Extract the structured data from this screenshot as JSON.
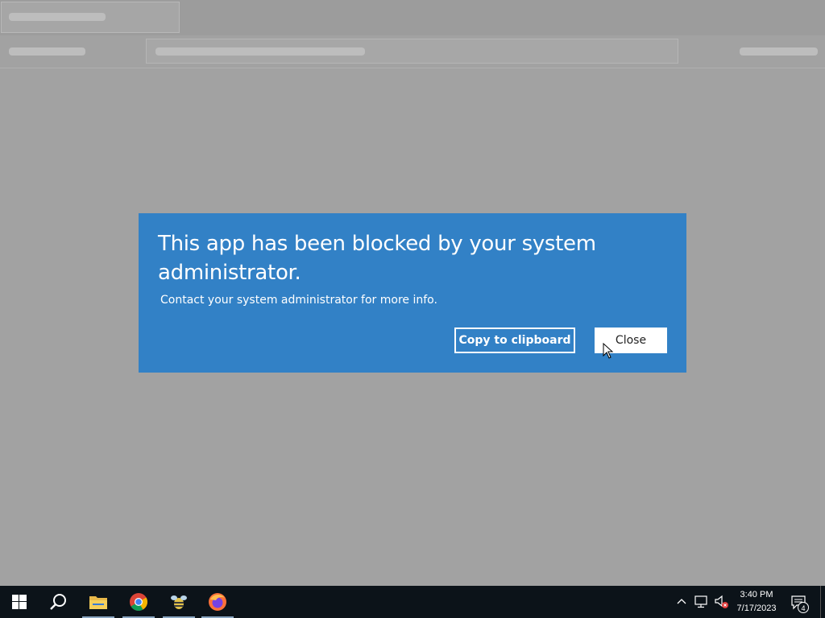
{
  "dialog": {
    "title": "This app has been blocked by your system administrator.",
    "message": "Contact your system administrator for more info.",
    "copy_button": "Copy to clipboard",
    "close_button": "Close",
    "background_color": "#3281c6"
  },
  "taskbar": {
    "items": [
      {
        "name": "start",
        "icon": "windows-logo-icon"
      },
      {
        "name": "search",
        "icon": "search-icon"
      },
      {
        "name": "file-explorer",
        "icon": "folder-icon"
      },
      {
        "name": "chrome",
        "icon": "chrome-icon"
      },
      {
        "name": "app",
        "icon": "bee-app-icon"
      },
      {
        "name": "firefox",
        "icon": "firefox-icon"
      }
    ],
    "time": "3:40 PM",
    "date": "7/17/2023",
    "notification_count": "4"
  }
}
